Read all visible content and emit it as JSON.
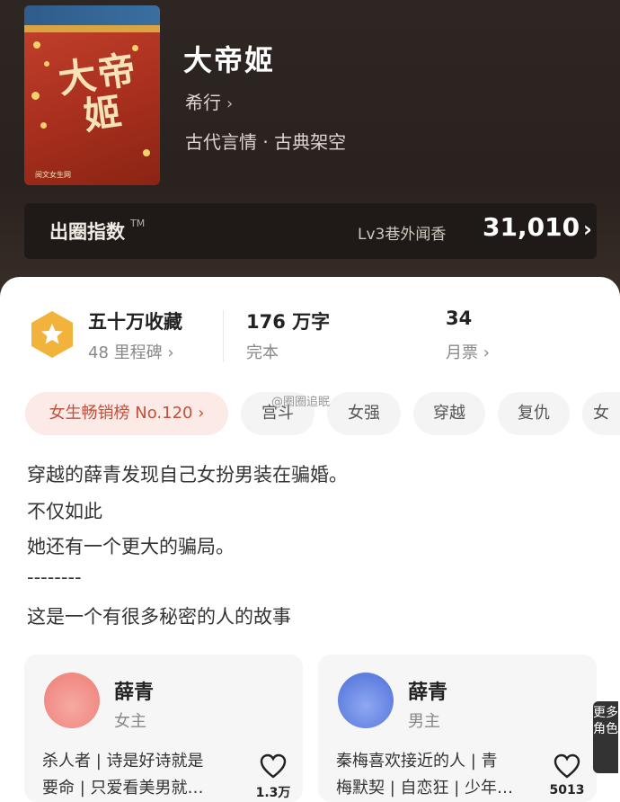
{
  "book": {
    "title": "大帝姬",
    "author": "希行",
    "author_chevron": "›",
    "genre": "古代言情 · 古典架空",
    "cover": {
      "art_text": "大帝姬",
      "publisher": "阅文女生网"
    }
  },
  "rank_bar": {
    "label": "出圈指数",
    "trademark": "TM",
    "level": "Lv3巷外闻香",
    "score": "31,010",
    "chevron": "›"
  },
  "stats": {
    "collect_title": "五十万收藏",
    "collect_sub": "48 里程碑",
    "words_title": "176 万字",
    "words_sub": "完本",
    "monthly_title": "34",
    "monthly_sub": "月票",
    "chevron": "›"
  },
  "tags": {
    "hot": "女生畅销榜 No.120",
    "hot_chevron": "›",
    "items": [
      "宫斗",
      "女强",
      "穿越",
      "复仇",
      "女"
    ]
  },
  "watermark": "@圈圈追眠",
  "description": {
    "line1": "穿越的薛青发现自己女扮男装在骗婚。",
    "line2": "不仅如此",
    "line3": "她还有一个更大的骗局。",
    "line4": "--------",
    "line5": "这是一个有很多秘密的人的故事"
  },
  "characters": [
    {
      "name": "薛青",
      "role": "女主",
      "desc1": "杀人者 | 诗是好诗就是",
      "desc2": "要命 | 只爱看美男就…",
      "likes": "1.3万"
    },
    {
      "name": "薛青",
      "role": "男主",
      "desc1": "秦梅喜欢接近的人 | 青",
      "desc2": "梅默契 | 自恋狂 | 少年…",
      "likes": "5013"
    }
  ],
  "more_roles": "更多角色",
  "colors": {
    "header_bg": "#2e2622",
    "hot_tag_bg": "#fbeae6",
    "hot_tag_text": "#c0513c",
    "badge": "#f2b33d"
  }
}
